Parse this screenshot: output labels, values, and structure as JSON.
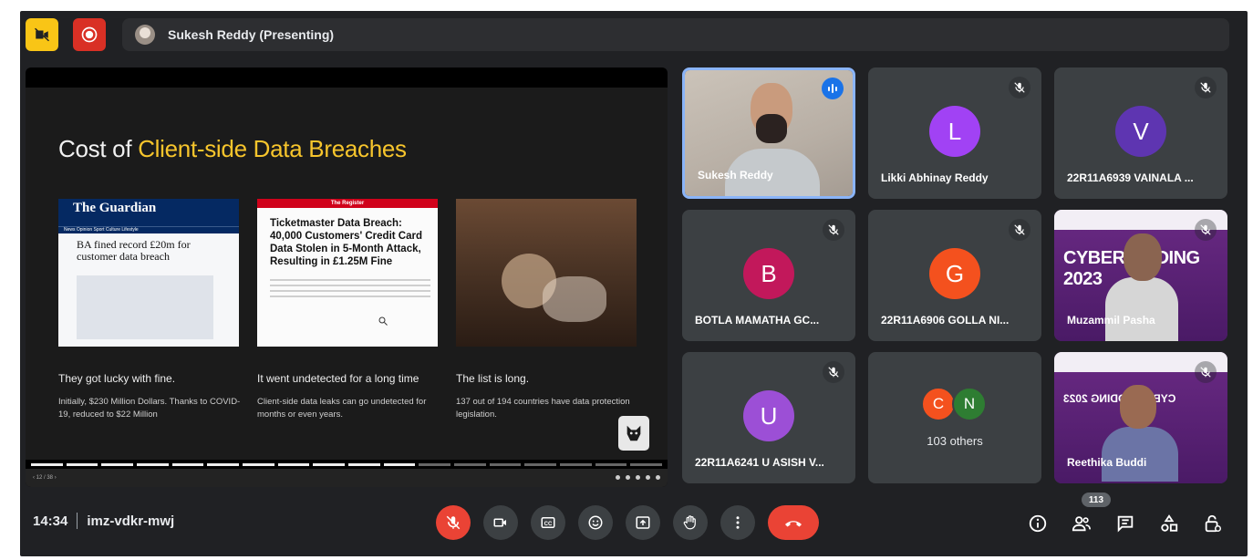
{
  "topbar": {
    "presenting_label": "Sukesh Reddy (Presenting)"
  },
  "slide": {
    "title_prefix": "Cost of ",
    "title_highlight": "Client-side Data Breaches",
    "articles": [
      {
        "masthead": "The Guardian",
        "nav": "News  Opinion  Sport  Culture  Lifestyle",
        "headline": "BA fined record £20m for customer data breach"
      },
      {
        "masthead": "The Register",
        "headline": "Ticketmaster Data Breach: 40,000 Customers' Credit Card Data Stolen in 5-Month Attack, Resulting in £1.25M Fine"
      }
    ],
    "columns": [
      {
        "title": "They got lucky with fine.",
        "text": "Initially, $230 Million Dollars. Thanks to COVID-19, reduced to $22 Million"
      },
      {
        "title": "It went undetected for a long time",
        "text": "Client-side data leaks can go undetected for months or even years."
      },
      {
        "title": "The list is long.",
        "text": "137 out of 194 countries have data protection legislation."
      }
    ],
    "page_indicator": "12 / 38",
    "progress": {
      "total_segments": 18,
      "filled_segments": 11
    }
  },
  "participants": [
    {
      "name": "Sukesh Reddy",
      "type": "camera",
      "speaking": true
    },
    {
      "name": "Likki Abhinay Reddy",
      "initial": "L",
      "color": "#a142f4",
      "muted": true
    },
    {
      "name": "22R11A6939 VAINALA ...",
      "initial": "V",
      "color": "#5e35b1",
      "muted": true
    },
    {
      "name": "BOTLA MAMATHA GC...",
      "initial": "B",
      "color": "#c2185b",
      "muted": true
    },
    {
      "name": "22R11A6906 GOLLA NI...",
      "initial": "G",
      "color": "#f4511e",
      "muted": true
    },
    {
      "name": "Muzammil Pasha",
      "type": "camera",
      "banner": "CYBER CODING 2023",
      "muted": true
    },
    {
      "name": "22R11A6241 U ASISH V...",
      "initial": "U",
      "color": "#9c4fd6",
      "muted": true
    },
    {
      "name": "Reethika Buddi",
      "type": "camera",
      "banner": "CYBER CODING 2023",
      "muted": true
    }
  ],
  "others": {
    "label": "103 others",
    "avatars": [
      {
        "initial": "C",
        "color": "#f4511e"
      },
      {
        "initial": "N",
        "color": "#2e7d32"
      }
    ]
  },
  "meeting": {
    "time": "14:34",
    "code": "imz-vdkr-mwj",
    "participant_count": "113"
  },
  "controls": [
    "mic-off-icon",
    "camera-icon",
    "captions-icon",
    "emoji-icon",
    "present-icon",
    "raise-hand-icon",
    "more-options-icon",
    "hang-up-icon"
  ],
  "right_controls": [
    "info-icon",
    "people-icon",
    "chat-icon",
    "activities-icon",
    "host-controls-icon"
  ],
  "colors": {
    "background": "#202124",
    "tile": "#3c4043",
    "accent_red": "#ea4335",
    "accent_blue": "#8ab4f8",
    "slide_highlight": "#f7c52c"
  }
}
